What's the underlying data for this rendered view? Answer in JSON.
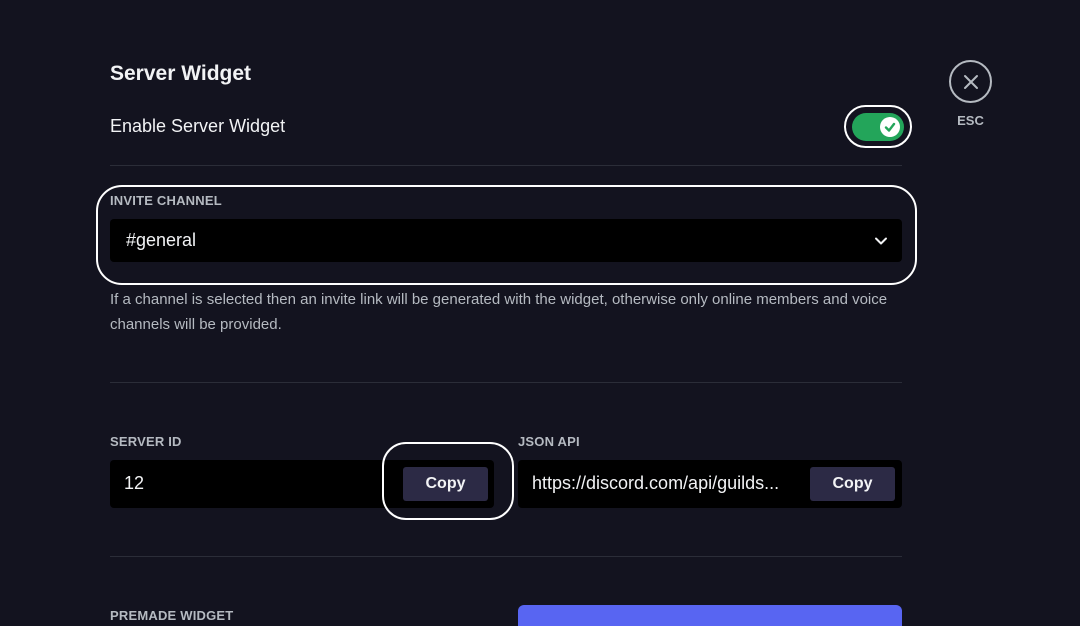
{
  "page": {
    "title": "Server Widget",
    "close": {
      "label": "ESC",
      "icon": "close-icon"
    },
    "enable_toggle": {
      "label": "Enable Server Widget",
      "enabled": true,
      "color": "#23a55a"
    },
    "invite_channel": {
      "label": "INVITE CHANNEL",
      "selected": "#general",
      "help_text": "If a channel is selected then an invite link will be generated with the widget, otherwise only online members and voice channels will be provided."
    },
    "server_id": {
      "label": "SERVER ID",
      "value": "12",
      "copy_label": "Copy"
    },
    "json_api": {
      "label": "JSON API",
      "value": "https://discord.com/api/guilds...",
      "copy_label": "Copy"
    },
    "premade_widget": {
      "label": "PREMADE WIDGET"
    },
    "colors": {
      "background": "#13131f",
      "accent": "#5865f2",
      "input_bg": "#000000"
    }
  }
}
